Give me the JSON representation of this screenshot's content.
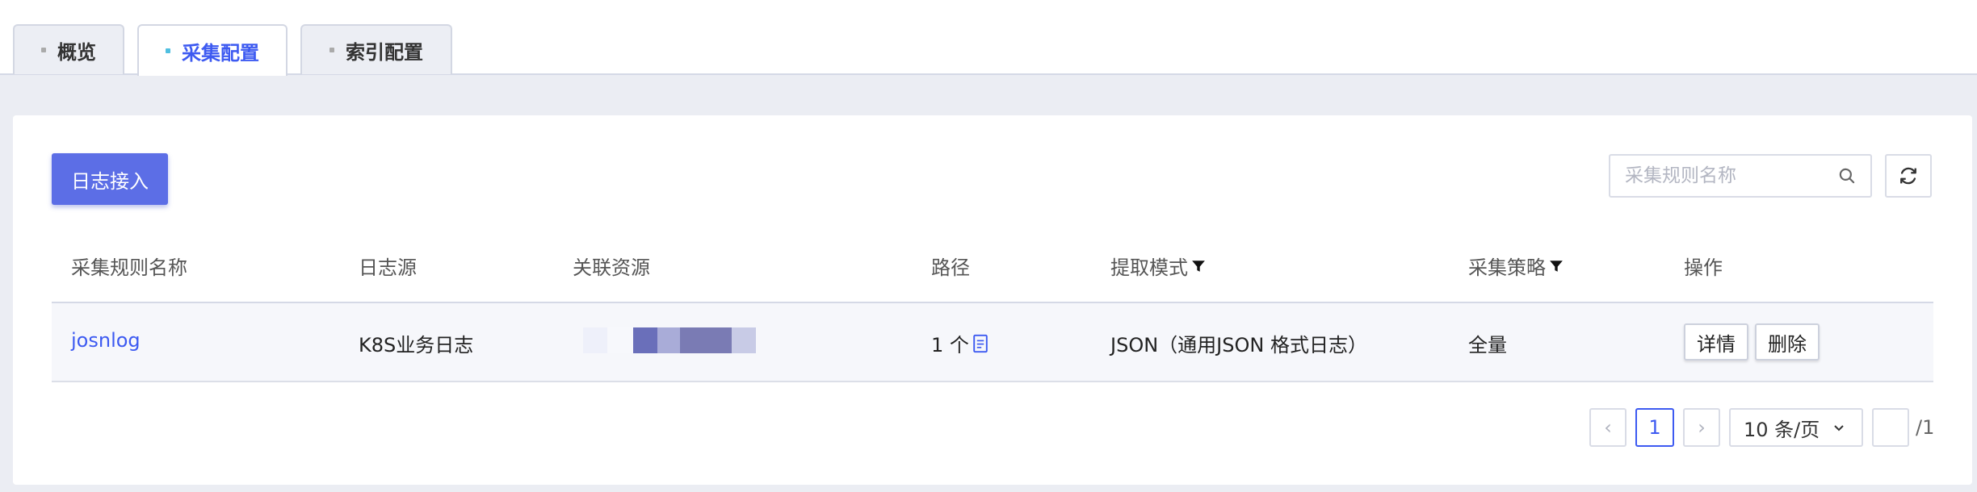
{
  "tabs": [
    {
      "label": "概览",
      "active": false
    },
    {
      "label": "采集配置",
      "active": true
    },
    {
      "label": "索引配置",
      "active": false
    }
  ],
  "toolbar": {
    "primary_button": "日志接入",
    "search_placeholder": "采集规则名称",
    "search_value": "",
    "refresh_icon": "refresh-icon"
  },
  "table": {
    "columns": [
      "采集规则名称",
      "日志源",
      "关联资源",
      "路径",
      "提取模式",
      "采集策略",
      "操作"
    ],
    "filterable_columns": [
      "提取模式",
      "采集策略"
    ],
    "rows": [
      {
        "name": "josnlog",
        "source": "K8S业务日志",
        "resource": "",
        "path": "1 个",
        "mode": "JSON（通用JSON 格式日志）",
        "strategy": "全量",
        "actions": [
          "详情",
          "删除"
        ]
      }
    ]
  },
  "pagination": {
    "prev": "‹",
    "current_page": "1",
    "next": "›",
    "page_size": "10 条/页",
    "jump_value": "",
    "total_pages": "/1"
  },
  "colors": {
    "accent": "#3d5af1",
    "primary_button": "#5c6ee6",
    "background": "#ebedf3"
  }
}
